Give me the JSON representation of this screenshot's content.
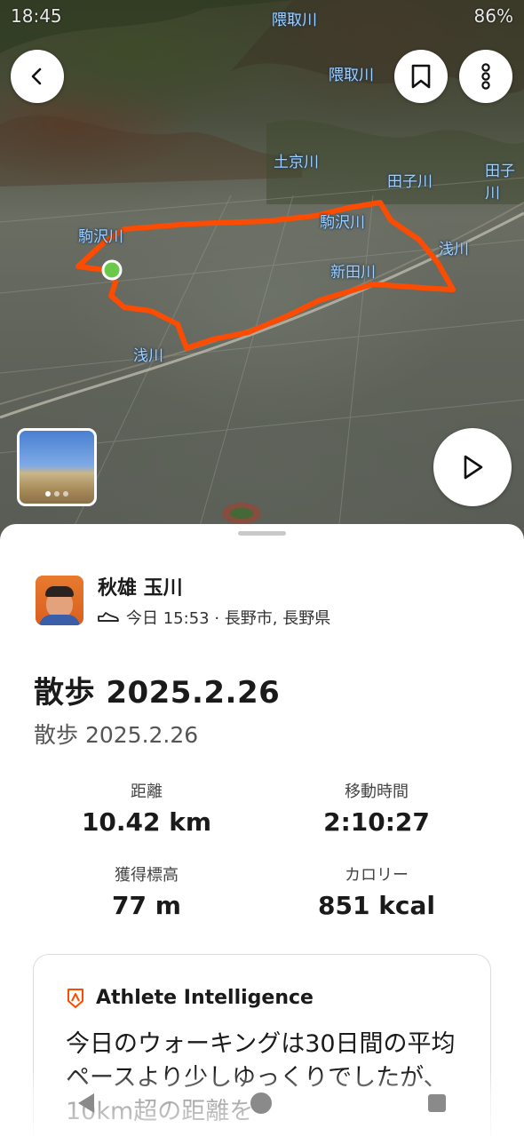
{
  "status": {
    "time": "18:45",
    "battery": "86%"
  },
  "map": {
    "rivers": [
      "隈取川",
      "隈取川",
      "土京川",
      "田子川",
      "田子川",
      "駒沢川",
      "駒沢川",
      "浅川",
      "新田川",
      "浅川"
    ],
    "route_color": "#fc4c02",
    "start_marker_color": "#6ac94a"
  },
  "photo": {
    "count": 3
  },
  "athlete": {
    "name": "秋雄 玉川",
    "meta": "今日 15:53 · 長野市, 長野県"
  },
  "activity": {
    "title": "散歩 2025.2.26",
    "subtitle": "散歩 2025.2.26"
  },
  "stats": [
    {
      "label": "距離",
      "value": "10.42 km"
    },
    {
      "label": "移動時間",
      "value": "2:10:27"
    },
    {
      "label": "獲得標高",
      "value": "77 m"
    },
    {
      "label": "カロリー",
      "value": "851 kcal"
    }
  ],
  "ai": {
    "title": "Athlete Intelligence",
    "text": "今日のウォーキングは30日間の平均ペースより少しゆっくりでしたが、10km超の距離を"
  },
  "colors": {
    "accent": "#fc4c02",
    "text": "#1a1a1a"
  }
}
